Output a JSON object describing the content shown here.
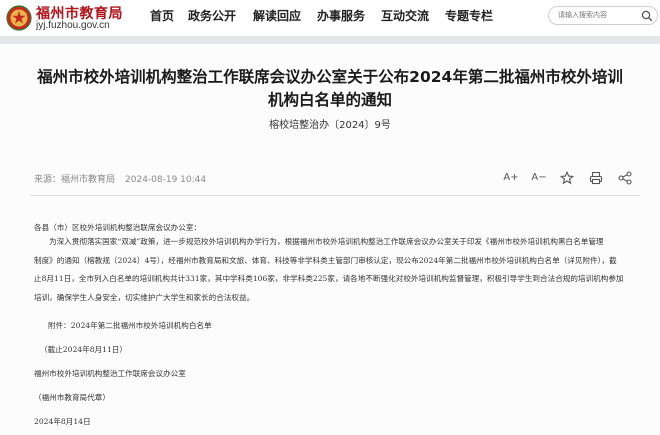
{
  "header": {
    "site_name": "福州市教育局",
    "site_url": "jyj.fuzhou.gov.cn",
    "nav": [
      "首页",
      "政务公开",
      "解读回应",
      "办事服务",
      "互动交流",
      "专题专栏"
    ],
    "search_placeholder": "请输入搜索内容"
  },
  "article": {
    "title_line1": "福州市校外培训机构整治工作联席会议办公室关于公布2024年第二批福州市校外培训",
    "title_line2": "机构白名单的通知",
    "doc_number": "榕校培整治办〔2024〕9号",
    "source": "来源：福州市教育局",
    "date": "2024-08-19 10:44",
    "tools": {
      "font_up": "A+",
      "font_down": "A−"
    },
    "addressee": "各县（市）区校外培训机构整治联席会议办公室：",
    "body_line1": "为深入贯彻落实国家“双减”政策，进一步规范校外培训机构办学行为，根据福州市校外培训机构整治工作联席会议办公室关于印发《福州市校外培训机构黑白名单管理",
    "body_line2": "制度》的通知（榕教规〔2024〕4号），经福州市教育局和文旅、体育、科技等非学科类主管部门审核认定，现公布2024年第二批福州市校外培训机构白名单（详见附件），截",
    "body_line3": "止8月11日，全市列入白名单的培训机构共计331家，其中学科类106家，非学科类225家，请各地不断强化对校外培训机构监督管理，积极引导学生到合法合规的培训机构参加",
    "body_line4": "培训，确保学生人身安全，切实维护广大学生和家长的合法权益。",
    "attachment": "附件：2024年第二批福州市校外培训机构白名单",
    "cutoff": "（截止2024年8月11日）",
    "signer": "福州市校外培训机构整治工作联席会议办公室",
    "signer_agent": "（福州市教育局代章）",
    "sign_date": "2024年8月14日"
  },
  "colors": {
    "brand_red": "#b0141c",
    "band_gray": "#e6e7ea"
  },
  "icons": [
    "emblem-logo-icon",
    "search-icon",
    "font-increase-icon",
    "font-decrease-icon",
    "star-icon",
    "print-icon",
    "share-icon"
  ]
}
